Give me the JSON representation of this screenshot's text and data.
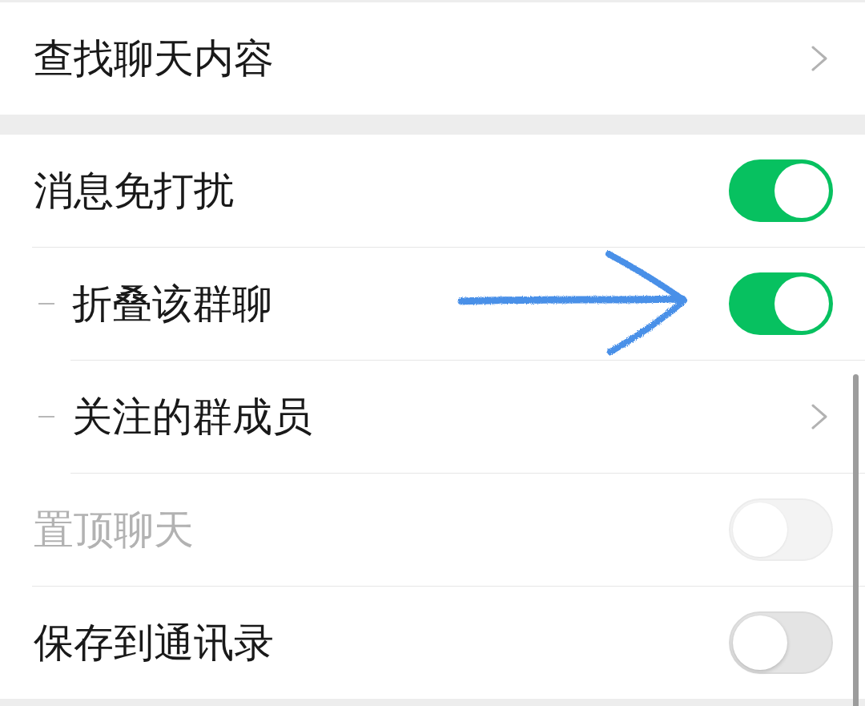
{
  "sections": [
    {
      "rows": [
        {
          "kind": "link",
          "label": "查找聊天内容",
          "disabled": false,
          "arrow_annotation": false
        }
      ]
    },
    {
      "rows": [
        {
          "kind": "switch",
          "label": "消息免打扰",
          "on": true,
          "disabled": false,
          "arrow_annotation": false,
          "children": [
            {
              "kind": "switch",
              "label": "折叠该群聊",
              "on": true,
              "disabled": false,
              "arrow_annotation": true
            },
            {
              "kind": "link",
              "label": "关注的群成员",
              "disabled": false,
              "arrow_annotation": false
            }
          ]
        },
        {
          "kind": "switch",
          "label": "置顶聊天",
          "on": false,
          "disabled": true,
          "arrow_annotation": false
        },
        {
          "kind": "switch",
          "label": "保存到通讯录",
          "on": false,
          "disabled": false,
          "arrow_annotation": false
        }
      ]
    }
  ]
}
